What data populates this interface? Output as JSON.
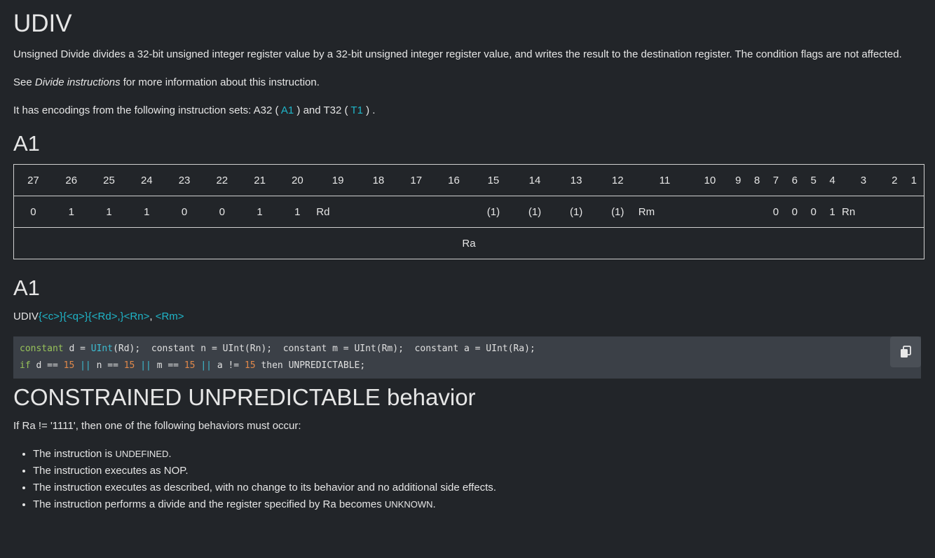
{
  "title": "UDIV",
  "intro": "Unsigned Divide divides a 32-bit unsigned integer register value by a 32-bit unsigned integer register value, and writes the result to the destination register. The condition flags are not affected.",
  "see": {
    "prefix": "See ",
    "link": "Divide instructions",
    "suffix": " for more information about this instruction."
  },
  "encodings_line": {
    "prefix": "It has encodings from the following instruction sets: A32 ( ",
    "a1": "A1",
    "middle": " ) and T32 ( ",
    "t1": "T1",
    "suffix": " ) ."
  },
  "section_a1": "A1",
  "encoding_table": {
    "bits": [
      "27",
      "26",
      "25",
      "24",
      "23",
      "22",
      "21",
      "20",
      "19",
      "18",
      "17",
      "16",
      "15",
      "14",
      "13",
      "12",
      "11",
      "10",
      "9",
      "8",
      "7",
      "6",
      "5",
      "4",
      "3",
      "2",
      "1"
    ],
    "values": [
      "0",
      "1",
      "1",
      "1",
      "0",
      "0",
      "1",
      "1",
      "Rd",
      "",
      "",
      "",
      "(1)",
      "(1)",
      "(1)",
      "(1)",
      "Rm",
      "",
      "",
      "",
      "0",
      "0",
      "0",
      "1",
      "Rn",
      "",
      ""
    ],
    "ra_label": "Ra"
  },
  "section_a1_syntax": "A1",
  "syntax": {
    "mnemonic": "UDIV",
    "c": "{<c>}",
    "q": "{<q>}",
    "rd": "{<Rd>,}",
    "rn": "<Rn>",
    "sep": ", ",
    "rm": "<Rm>"
  },
  "code": {
    "line1": [
      {
        "t": "constant",
        "c": "kw"
      },
      {
        "t": " d = ",
        "c": ""
      },
      {
        "t": "UInt",
        "c": "fn"
      },
      {
        "t": "(Rd);  constant n = UInt(Rn);  constant m = UInt(Rm);  constant a = UInt(Ra);",
        "c": ""
      }
    ],
    "line2": [
      {
        "t": "if",
        "c": "kw"
      },
      {
        "t": " d == ",
        "c": ""
      },
      {
        "t": "15",
        "c": "num"
      },
      {
        "t": " || ",
        "c": "orop"
      },
      {
        "t": "n == ",
        "c": ""
      },
      {
        "t": "15",
        "c": "num"
      },
      {
        "t": " || ",
        "c": "orop"
      },
      {
        "t": "m == ",
        "c": ""
      },
      {
        "t": "15",
        "c": "num"
      },
      {
        "t": " || ",
        "c": "orop"
      },
      {
        "t": "a != ",
        "c": ""
      },
      {
        "t": "15",
        "c": "num"
      },
      {
        "t": " then UNPREDICTABLE;",
        "c": ""
      }
    ]
  },
  "section_constrained": "CONSTRAINED UNPREDICTABLE behavior",
  "constrained_intro": "If Ra != '1111', then one of the following behaviors must occur:",
  "behaviors": [
    {
      "text": "The instruction is ",
      "sc": "UNDEFINED",
      "end": "."
    },
    {
      "text": "The instruction executes as NOP.",
      "sc": "",
      "end": ""
    },
    {
      "text": "The instruction executes as described, with no change to its behavior and no additional side effects.",
      "sc": "",
      "end": ""
    },
    {
      "text": "The instruction performs a divide and the register specified by Ra becomes ",
      "sc": "UNKNOWN",
      "end": "."
    }
  ],
  "icons": {
    "copy": "copy-icon"
  }
}
